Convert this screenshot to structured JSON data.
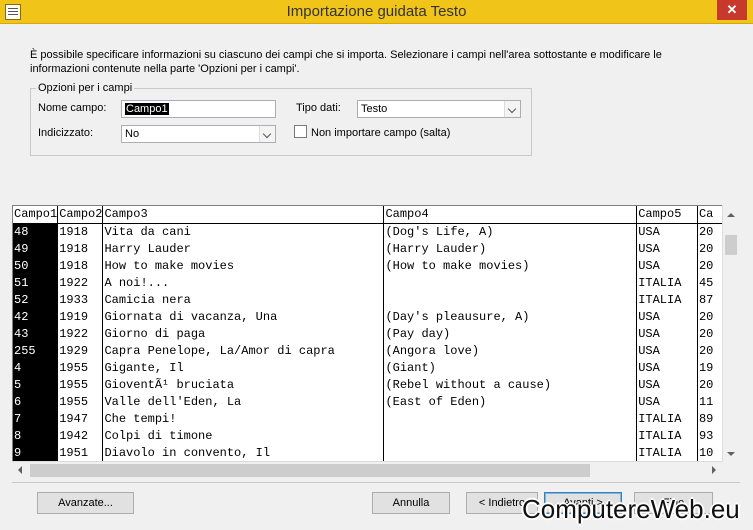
{
  "window": {
    "title": "Importazione guidata Testo",
    "close_glyph": "✕"
  },
  "description": "È possibile specificare informazioni su ciascuno dei campi che si importa. Selezionare i campi nell'area sottostante e modificare le informazioni contenute nella parte 'Opzioni per i campi'.",
  "options": {
    "legend": "Opzioni per i campi",
    "field_name_label": "Nome campo:",
    "field_name_value": "Campo1",
    "data_type_label": "Tipo dati:",
    "data_type_value": "Testo",
    "indexed_label": "Indicizzato:",
    "indexed_value": "No",
    "skip_label": "Non importare campo (salta)",
    "skip_checked": false
  },
  "grid": {
    "headers": [
      "Campo1",
      "Campo2",
      "Campo3",
      "Campo4",
      "Campo5",
      "Ca"
    ],
    "rows": [
      [
        "48",
        "1918",
        "Vita da cani",
        "(Dog's Life, A)",
        "USA",
        "20"
      ],
      [
        "49",
        "1918",
        "Harry Lauder",
        "(Harry Lauder)",
        "USA",
        "20"
      ],
      [
        "50",
        "1918",
        "How to make movies",
        "(How to make movies)",
        "USA",
        "20"
      ],
      [
        "51",
        "1922",
        "A noi!...",
        "",
        "ITALIA",
        "45"
      ],
      [
        "52",
        "1933",
        "Camicia nera",
        "",
        "ITALIA",
        "87"
      ],
      [
        "42",
        "1919",
        "Giornata di vacanza, Una",
        "(Day's pleausure, A)",
        "USA",
        "20"
      ],
      [
        "43",
        "1922",
        "Giorno di paga",
        "(Pay day)",
        "USA",
        "20"
      ],
      [
        "255",
        "1929",
        "Capra Penelope, La/Amor di capra",
        "(Angora love)",
        "USA",
        "20"
      ],
      [
        "4",
        "1955",
        "Gigante, Il",
        "(Giant)",
        "USA",
        "19"
      ],
      [
        "5",
        "1955",
        "GioventÃ¹ bruciata",
        "(Rebel without a cause)",
        "USA",
        "20"
      ],
      [
        "6",
        "1955",
        "Valle dell'Eden, La",
        "(East of Eden)",
        "USA",
        "11"
      ],
      [
        "7",
        "1947",
        "Che tempi!",
        "",
        "ITALIA",
        "89"
      ],
      [
        "8",
        "1942",
        "Colpi di timone",
        "",
        "ITALIA",
        "93"
      ],
      [
        "9",
        "1951",
        "Diavolo in convento, Il",
        "",
        "ITALIA",
        "10"
      ]
    ]
  },
  "buttons": {
    "advanced": "Avanzate...",
    "cancel": "Annulla",
    "back": "< Indietro",
    "next": "Avanti >",
    "finish": "Fine"
  },
  "watermark": "ComputereWeb.eu",
  "colors": {
    "titlebar": "#f0c418",
    "close": "#c7392b",
    "selection": "#000000"
  }
}
